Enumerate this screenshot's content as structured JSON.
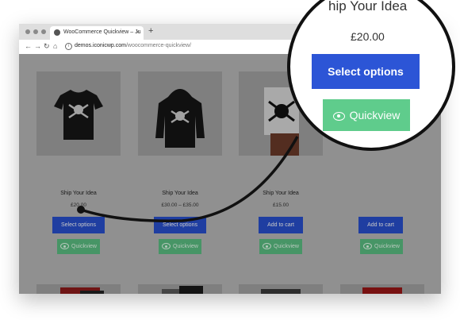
{
  "browser": {
    "tab_title": "WooCommerce Quickview – Ju",
    "close_glyph": "×",
    "new_tab_glyph": "+",
    "url_host": "demos.iconicwp.com",
    "url_path": "/woocommerce-quickview/"
  },
  "products": [
    {
      "name": "Ship Your Idea",
      "price": "£20.00",
      "primary": "Select options",
      "quickview": "Quickview"
    },
    {
      "name": "Ship Your Idea",
      "price": "£30.00 – £35.00",
      "primary": "Select options",
      "quickview": "Quickview"
    },
    {
      "name": "Ship Your Idea",
      "price": "£15.00",
      "primary": "Add to cart",
      "quickview": "Quickview"
    },
    {
      "name": "",
      "price": "",
      "primary": "Add to cart",
      "quickview": "Quickview"
    }
  ],
  "zoom": {
    "name": "hip Your Idea",
    "price": "£20.00",
    "select_label": "Select options",
    "quickview_label": "Quickview"
  },
  "colors": {
    "blue_button": "#2850cf",
    "green_button": "#5cbf83",
    "zoom_blue": "#2c55d6",
    "zoom_green": "#5fcc8c"
  },
  "icons": [
    "globe-icon",
    "back-icon",
    "forward-icon",
    "reload-icon",
    "home-icon",
    "info-icon",
    "eye-icon",
    "more-icon"
  ]
}
